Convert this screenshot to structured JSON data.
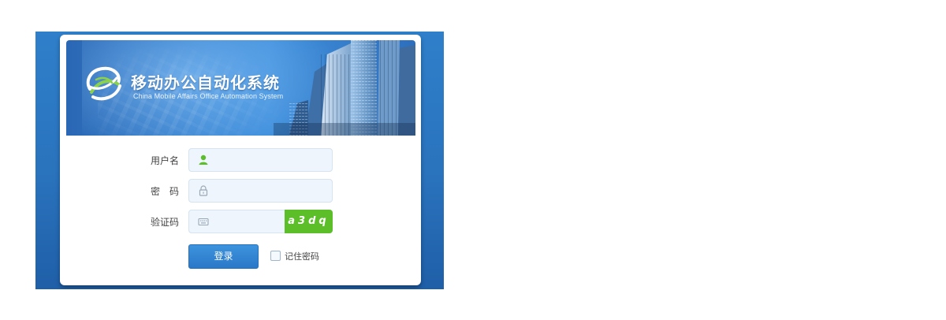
{
  "banner": {
    "title": "移动办公自动化系统",
    "subtitle": "China Mobile Affairs Office Automation System"
  },
  "form": {
    "username": {
      "label": "用户名",
      "value": "",
      "icon": "user-icon"
    },
    "password": {
      "label": "密　码",
      "value": "",
      "icon": "lock-icon"
    },
    "captcha": {
      "label": "验证码",
      "value": "",
      "icon": "keyboard-icon",
      "code": "a3dq"
    }
  },
  "actions": {
    "login_label": "登录",
    "remember_label": "记住密码",
    "remember_checked": false
  },
  "colors": {
    "page_bg": "#2a73bd",
    "banner": "#3a86d3",
    "captcha_bg": "#5cbf2a",
    "login_btn": "#2a78c8",
    "field_bg": "#eef5fd"
  }
}
